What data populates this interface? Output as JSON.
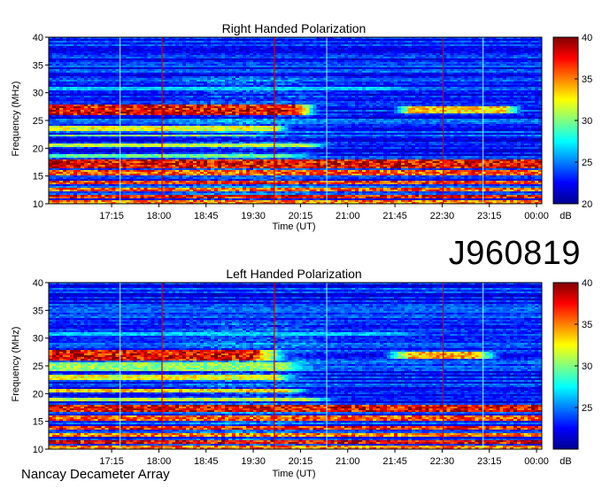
{
  "observation_id": "J960819",
  "instrument": "Nancay Decameter Array",
  "colormap": [
    "#00008f",
    "#0000ff",
    "#0080ff",
    "#00ffff",
    "#80ff80",
    "#ffff00",
    "#ff8000",
    "#ff0000",
    "#800000"
  ],
  "chart_data": [
    {
      "type": "heatmap",
      "title": "Right Handed Polarization",
      "xlabel": "Time (UT)",
      "ylabel": "Frequency (MHz)",
      "x_ticks": [
        "17:15",
        "18:00",
        "18:45",
        "19:30",
        "20:15",
        "21:00",
        "21:45",
        "22:30",
        "23:15",
        "00:00"
      ],
      "x_range_minutes": [
        975,
        1445
      ],
      "ylim": [
        10,
        40
      ],
      "y_ticks": [
        10,
        15,
        20,
        25,
        30,
        35,
        40
      ],
      "colorbar": {
        "label": "dB",
        "range": [
          20,
          40
        ],
        "ticks": [
          20,
          25,
          30,
          35,
          40
        ]
      },
      "red_markers_minutes": [
        1083,
        1190,
        1351
      ],
      "bright_vertical_lines_minutes": [
        1043,
        1240,
        1389
      ],
      "bands": [
        {
          "freq": [
            26.0,
            28.0
          ],
          "level": 39,
          "t_end": 1210,
          "fade": 25
        },
        {
          "freq": [
            26.4,
            27.6
          ],
          "level": 34,
          "t_start": 1320,
          "t_end": 1410,
          "fade": 20
        },
        {
          "freq": [
            23.0,
            24.0
          ],
          "level": 33,
          "t_end": 1190,
          "fade": 20
        },
        {
          "freq": [
            22.0,
            22.6
          ],
          "level": 31,
          "t_end": 1170,
          "fade": 20
        },
        {
          "freq": [
            20.2,
            20.8
          ],
          "level": 32,
          "t_end": 1220,
          "fade": 30
        },
        {
          "freq": [
            18.2,
            19.0
          ],
          "level": 30,
          "t_end": 1200,
          "fade": 40
        },
        {
          "freq": [
            16.5,
            18.0
          ],
          "level": 39,
          "t_end": 1440,
          "fade": 150
        },
        {
          "freq": [
            15.0,
            16.0
          ],
          "level": 37,
          "t_end": 1440,
          "fade": 200
        },
        {
          "freq": [
            13.5,
            14.2
          ],
          "level": 38,
          "t_end": 1440,
          "fade": 200
        },
        {
          "freq": [
            12.2,
            12.8
          ],
          "level": 37,
          "t_end": 1440,
          "fade": 250
        },
        {
          "freq": [
            11.0,
            11.7
          ],
          "level": 39,
          "t_end": 1440,
          "fade": 250
        },
        {
          "freq": [
            10.0,
            10.6
          ],
          "level": 36,
          "t_end": 1440,
          "fade": 250
        },
        {
          "freq": [
            30.5,
            31.0
          ],
          "level": 27,
          "t_end": 1300,
          "fade": 60
        },
        {
          "freq": [
            34.5,
            35.0
          ],
          "level": 25,
          "t_end": 1440,
          "fade": 200
        }
      ]
    },
    {
      "type": "heatmap",
      "title": "Left Handed Polarization",
      "xlabel": "Time (UT)",
      "ylabel": "Frequency (MHz)",
      "x_ticks": [
        "17:15",
        "18:00",
        "18:45",
        "19:30",
        "20:15",
        "21:00",
        "21:45",
        "22:30",
        "23:15",
        "00:00"
      ],
      "x_range_minutes": [
        975,
        1445
      ],
      "ylim": [
        10,
        40
      ],
      "y_ticks": [
        10,
        15,
        20,
        25,
        30,
        35,
        40
      ],
      "colorbar": {
        "label": "dB",
        "range": [
          20,
          40
        ],
        "ticks": [
          25,
          30,
          35,
          40
        ]
      },
      "red_markers_minutes": [
        1083,
        1190,
        1351
      ],
      "bright_vertical_lines_minutes": [
        1043,
        1240,
        1389
      ],
      "bands": [
        {
          "freq": [
            26.0,
            28.0
          ],
          "level": 39,
          "t_end": 1170,
          "fade": 40
        },
        {
          "freq": [
            26.4,
            27.4
          ],
          "level": 35,
          "t_start": 1320,
          "t_end": 1380,
          "fade": 30
        },
        {
          "freq": [
            24.0,
            25.5
          ],
          "level": 31,
          "t_end": 1200,
          "fade": 40
        },
        {
          "freq": [
            22.6,
            23.4
          ],
          "level": 33,
          "t_end": 1190,
          "fade": 30
        },
        {
          "freq": [
            20.2,
            21.0
          ],
          "level": 34,
          "t_end": 1200,
          "fade": 30
        },
        {
          "freq": [
            18.6,
            19.4
          ],
          "level": 32,
          "t_end": 1220,
          "fade": 40
        },
        {
          "freq": [
            16.8,
            18.0
          ],
          "level": 39,
          "t_end": 1440,
          "fade": 120
        },
        {
          "freq": [
            15.0,
            16.0
          ],
          "level": 37,
          "t_end": 1440,
          "fade": 200
        },
        {
          "freq": [
            13.6,
            14.2
          ],
          "level": 38,
          "t_end": 1440,
          "fade": 200
        },
        {
          "freq": [
            12.2,
            12.8
          ],
          "level": 36,
          "t_end": 1440,
          "fade": 250
        },
        {
          "freq": [
            11.0,
            11.7
          ],
          "level": 39,
          "t_end": 1440,
          "fade": 250
        },
        {
          "freq": [
            10.0,
            10.6
          ],
          "level": 36,
          "t_end": 1440,
          "fade": 250
        },
        {
          "freq": [
            30.5,
            31.0
          ],
          "level": 27,
          "t_end": 1300,
          "fade": 60
        },
        {
          "freq": [
            34.5,
            35.0
          ],
          "level": 25,
          "t_end": 1440,
          "fade": 200
        }
      ]
    }
  ]
}
